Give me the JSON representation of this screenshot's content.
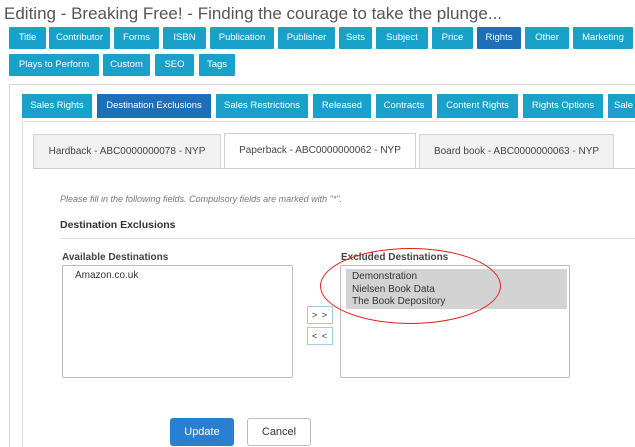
{
  "page": {
    "title": "Editing - Breaking Free! - Finding the courage to take the plunge..."
  },
  "main_nav": [
    {
      "label": "Title",
      "active": false
    },
    {
      "label": "Contributor",
      "active": false
    },
    {
      "label": "Forms",
      "active": false
    },
    {
      "label": "ISBN",
      "active": false
    },
    {
      "label": "Publication",
      "active": false
    },
    {
      "label": "Publisher",
      "active": false
    },
    {
      "label": "Sets",
      "active": false
    },
    {
      "label": "Subject",
      "active": false
    },
    {
      "label": "Price",
      "active": false
    },
    {
      "label": "Rights",
      "active": true
    },
    {
      "label": "Other",
      "active": false
    },
    {
      "label": "Marketing",
      "active": false
    },
    {
      "label": "Plays to Perform",
      "active": false
    },
    {
      "label": "Custom",
      "active": false
    },
    {
      "label": "SEO",
      "active": false
    },
    {
      "label": "Tags",
      "active": false
    }
  ],
  "sub_nav": [
    {
      "label": "Sales Rights",
      "active": false
    },
    {
      "label": "Destination Exclusions",
      "active": true
    },
    {
      "label": "Sales Restrictions",
      "active": false
    },
    {
      "label": "Released",
      "active": false
    },
    {
      "label": "Contracts",
      "active": false
    },
    {
      "label": "Content Rights",
      "active": false
    },
    {
      "label": "Rights Options",
      "active": false
    },
    {
      "label": "Sale",
      "active": false
    }
  ],
  "format_tabs": [
    {
      "label": "Hardback - ABC0000000078 - NYP",
      "active": false
    },
    {
      "label": "Paperback - ABC0000000062 - NYP",
      "active": true
    },
    {
      "label": "Board book - ABC0000000063 - NYP",
      "active": false
    }
  ],
  "form": {
    "hint": "Please fill in the following fields. Compulsory fields are marked with \"*\".",
    "section_title": "Destination Exclusions",
    "available_label": "Available Destinations",
    "excluded_label": "Excluded Destinations",
    "available": [
      "Amazon.co.uk"
    ],
    "excluded": [
      "Demonstration",
      "Nielsen Book Data",
      "The Book Depository"
    ],
    "move_right_label": "> >",
    "move_left_label": "< <"
  },
  "actions": {
    "update_label": "Update",
    "cancel_label": "Cancel"
  },
  "colors": {
    "nav": "#1aa1c9",
    "nav_active": "#1f6fb8",
    "highlight_ring": "#e0221c",
    "update_button": "#2a7fd0"
  }
}
